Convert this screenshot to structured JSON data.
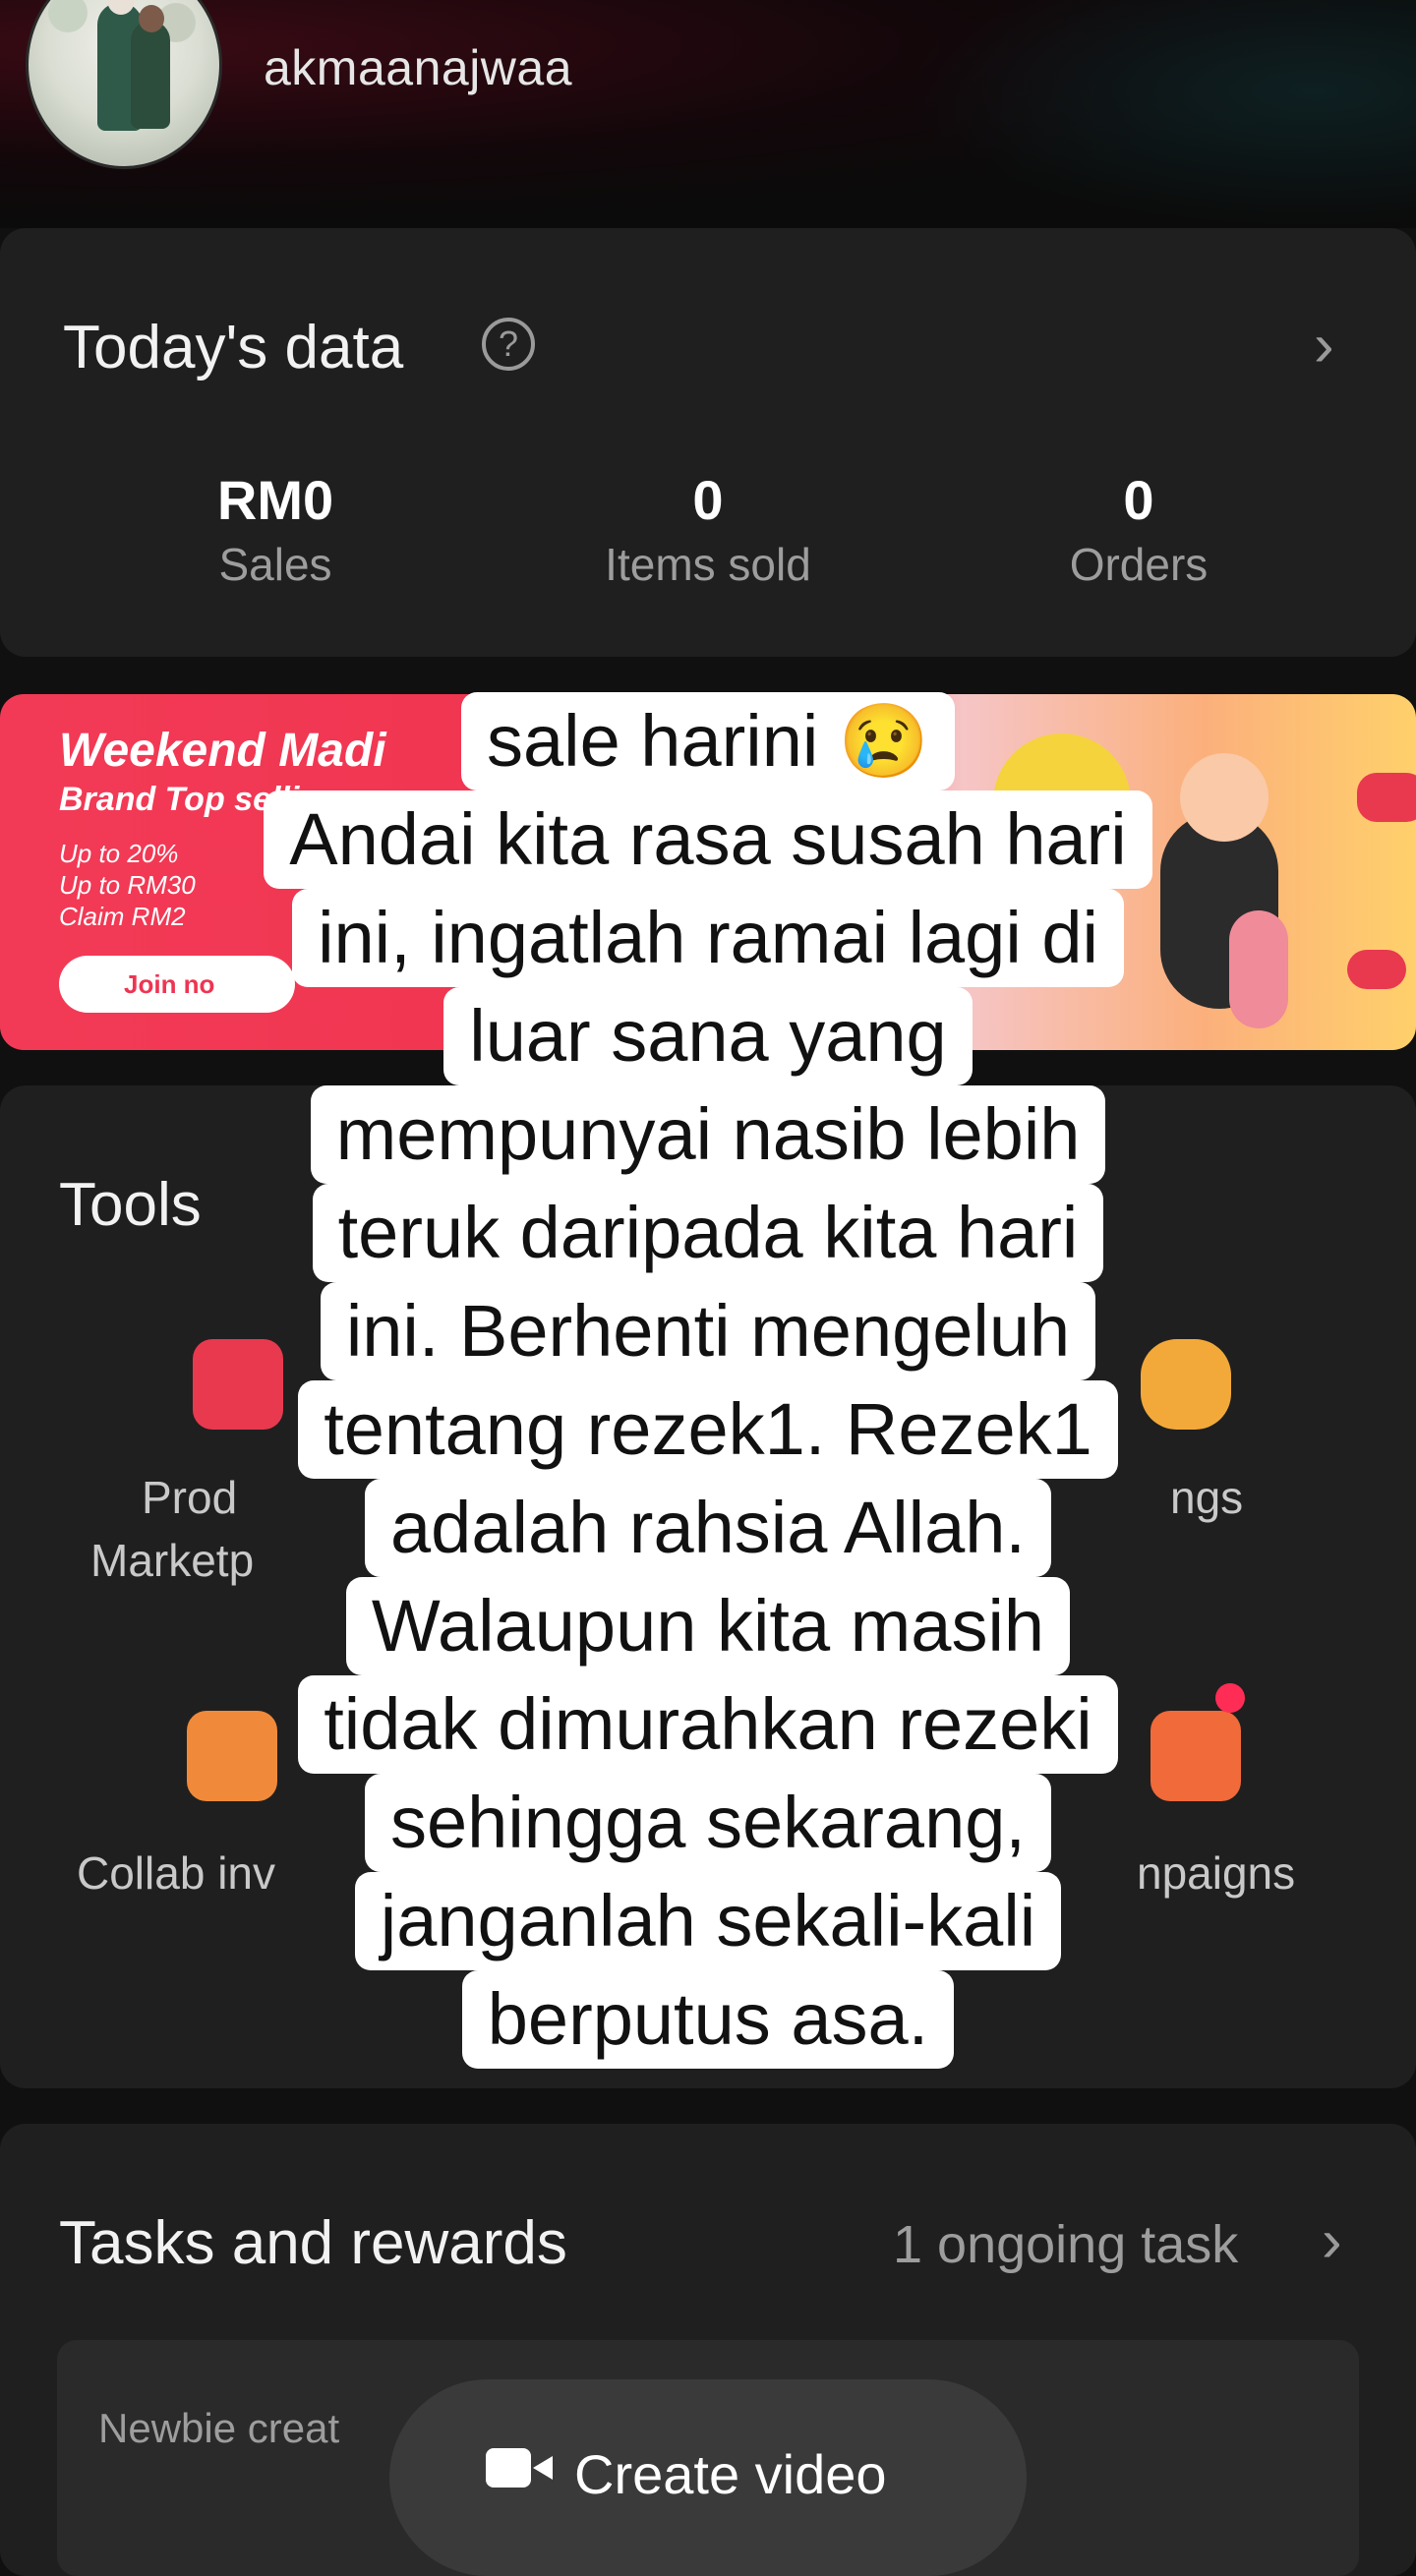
{
  "profile": {
    "username": "akmaanajwaa"
  },
  "today": {
    "title": "Today's data",
    "stats": [
      {
        "value": "RM0",
        "label": "Sales"
      },
      {
        "value": "0",
        "label": "Items sold"
      },
      {
        "value": "0",
        "label": "Orders"
      }
    ]
  },
  "banner": {
    "title": "Weekend Madi",
    "subtitle": "Brand Top selling",
    "lines": [
      "Up to 20%",
      "Up to RM30",
      "Claim RM2"
    ],
    "button": "Join no"
  },
  "tools": {
    "title": "Tools",
    "items": [
      {
        "label_line1": "Prod",
        "label_line2": "Marketp"
      },
      {
        "label_line1": "ngs",
        "label_line2": ""
      },
      {
        "label_line1": "Collab inv",
        "label_line2": ""
      },
      {
        "label_line1": "npaigns",
        "label_line2": ""
      }
    ]
  },
  "tasks": {
    "title": "Tasks and rewards",
    "ongoing": "1 ongoing task",
    "task_label": "Newbie creat"
  },
  "create": {
    "label": "Create video"
  },
  "caption": {
    "lines": [
      "sale harini 😢",
      "Andai kita rasa susah hari",
      "ini, ingatlah ramai lagi di",
      "luar sana yang",
      "mempunyai nasib lebih",
      "teruk daripada kita hari",
      "ini. Berhenti mengeluh",
      "tentang rezek1. Rezek1",
      "adalah rahsia Allah.",
      "Walaupun kita masih",
      "tidak dimurahkan rezeki",
      "sehingga sekarang,",
      "janganlah sekali-kali",
      "berputus asa."
    ]
  },
  "colors": {
    "background": "#101010",
    "card": "#1f1f1f",
    "banner_red": "#f23a56",
    "caption_bg": "#ffffff"
  }
}
